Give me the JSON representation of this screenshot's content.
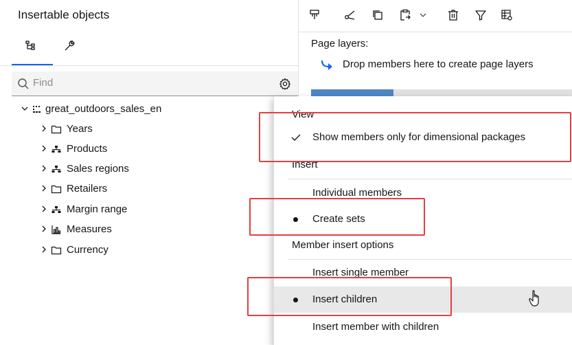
{
  "left_panel": {
    "title": "Insertable objects",
    "tabs": [
      {
        "icon": "source-tree-icon",
        "active": true
      },
      {
        "icon": "wrench-icon",
        "active": false
      }
    ],
    "find_placeholder": "Find",
    "tree": {
      "root": {
        "label": "great_outdoors_sales_en",
        "icon": "package-icon",
        "expanded": true
      },
      "children": [
        {
          "label": "Years",
          "icon": "folder-icon"
        },
        {
          "label": "Products",
          "icon": "hierarchy-icon"
        },
        {
          "label": "Sales regions",
          "icon": "hierarchy-icon"
        },
        {
          "label": "Retailers",
          "icon": "folder-icon"
        },
        {
          "label": "Margin range",
          "icon": "hierarchy-icon"
        },
        {
          "label": "Measures",
          "icon": "measures-icon"
        },
        {
          "label": "Currency",
          "icon": "folder-icon"
        }
      ]
    }
  },
  "toolbar": {
    "icons": [
      "pin-icon",
      "cut-icon",
      "copy-icon",
      "paste-icon",
      "chevron-down-icon",
      "delete-icon",
      "filter-icon",
      "table-settings-icon"
    ]
  },
  "page_layers": {
    "label": "Page layers:",
    "drop_hint": "Drop members here to create page layers"
  },
  "menu": {
    "sections": {
      "view": "View",
      "insert": "Insert",
      "member_insert_options": "Member insert options"
    },
    "items": {
      "show_members_only": "Show members only for dimensional packages",
      "individual_members": "Individual members",
      "create_sets": "Create sets",
      "insert_single_member": "Insert single member",
      "insert_children": "Insert children",
      "insert_member_with_children": "Insert member with children"
    },
    "state": {
      "show_members_only_checked": true,
      "insert_mode_selected": "Create sets",
      "member_insert_selected": "Insert children"
    }
  },
  "colors": {
    "accent": "#0f62fe",
    "highlight_box": "#e04040",
    "hover_row": "#e8e8e8"
  }
}
